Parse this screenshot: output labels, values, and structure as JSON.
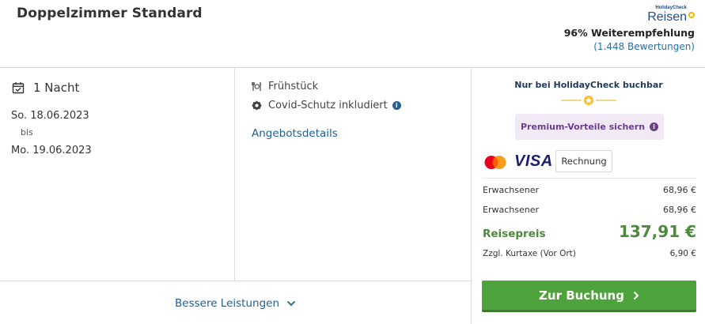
{
  "room": {
    "title": "Doppelzimmer Standard"
  },
  "brand": {
    "logo_small": "HolidayCheck",
    "logo_big": "Reisen",
    "recommendation": "96% Weiterempfehlung",
    "reviews": "(1.448 Bewertungen)"
  },
  "stay": {
    "nights": "1 Nacht",
    "date_from": "So. 18.06.2023",
    "bis": "bis",
    "date_to": "Mo. 19.06.2023"
  },
  "features": {
    "breakfast": "Frühstück",
    "covid": "Covid-Schutz inkludiert",
    "details_link": "Angebotsdetails"
  },
  "better_services": "Bessere Leistungen",
  "booking": {
    "exclusive": "Nur bei HolidayCheck buchbar",
    "premium": "Premium-Vorteile sichern",
    "visa": "VISA",
    "invoice": "Rechnung",
    "prices": [
      {
        "label": "Erwachsener",
        "value": "68,96 €"
      },
      {
        "label": "Erwachsener",
        "value": "68,96 €"
      }
    ],
    "total_label": "Reisepreis",
    "total_value": "137,91 €",
    "tax_label": "Zzgl. Kurtaxe (Vor Ort)",
    "tax_value": "6,90 €",
    "book_button": "Zur Buchung"
  },
  "colors": {
    "accent_blue": "#1f5f96",
    "price_green": "#4c8a3c",
    "button_green": "#4fa33c",
    "premium_purple": "#6a3d8e"
  }
}
